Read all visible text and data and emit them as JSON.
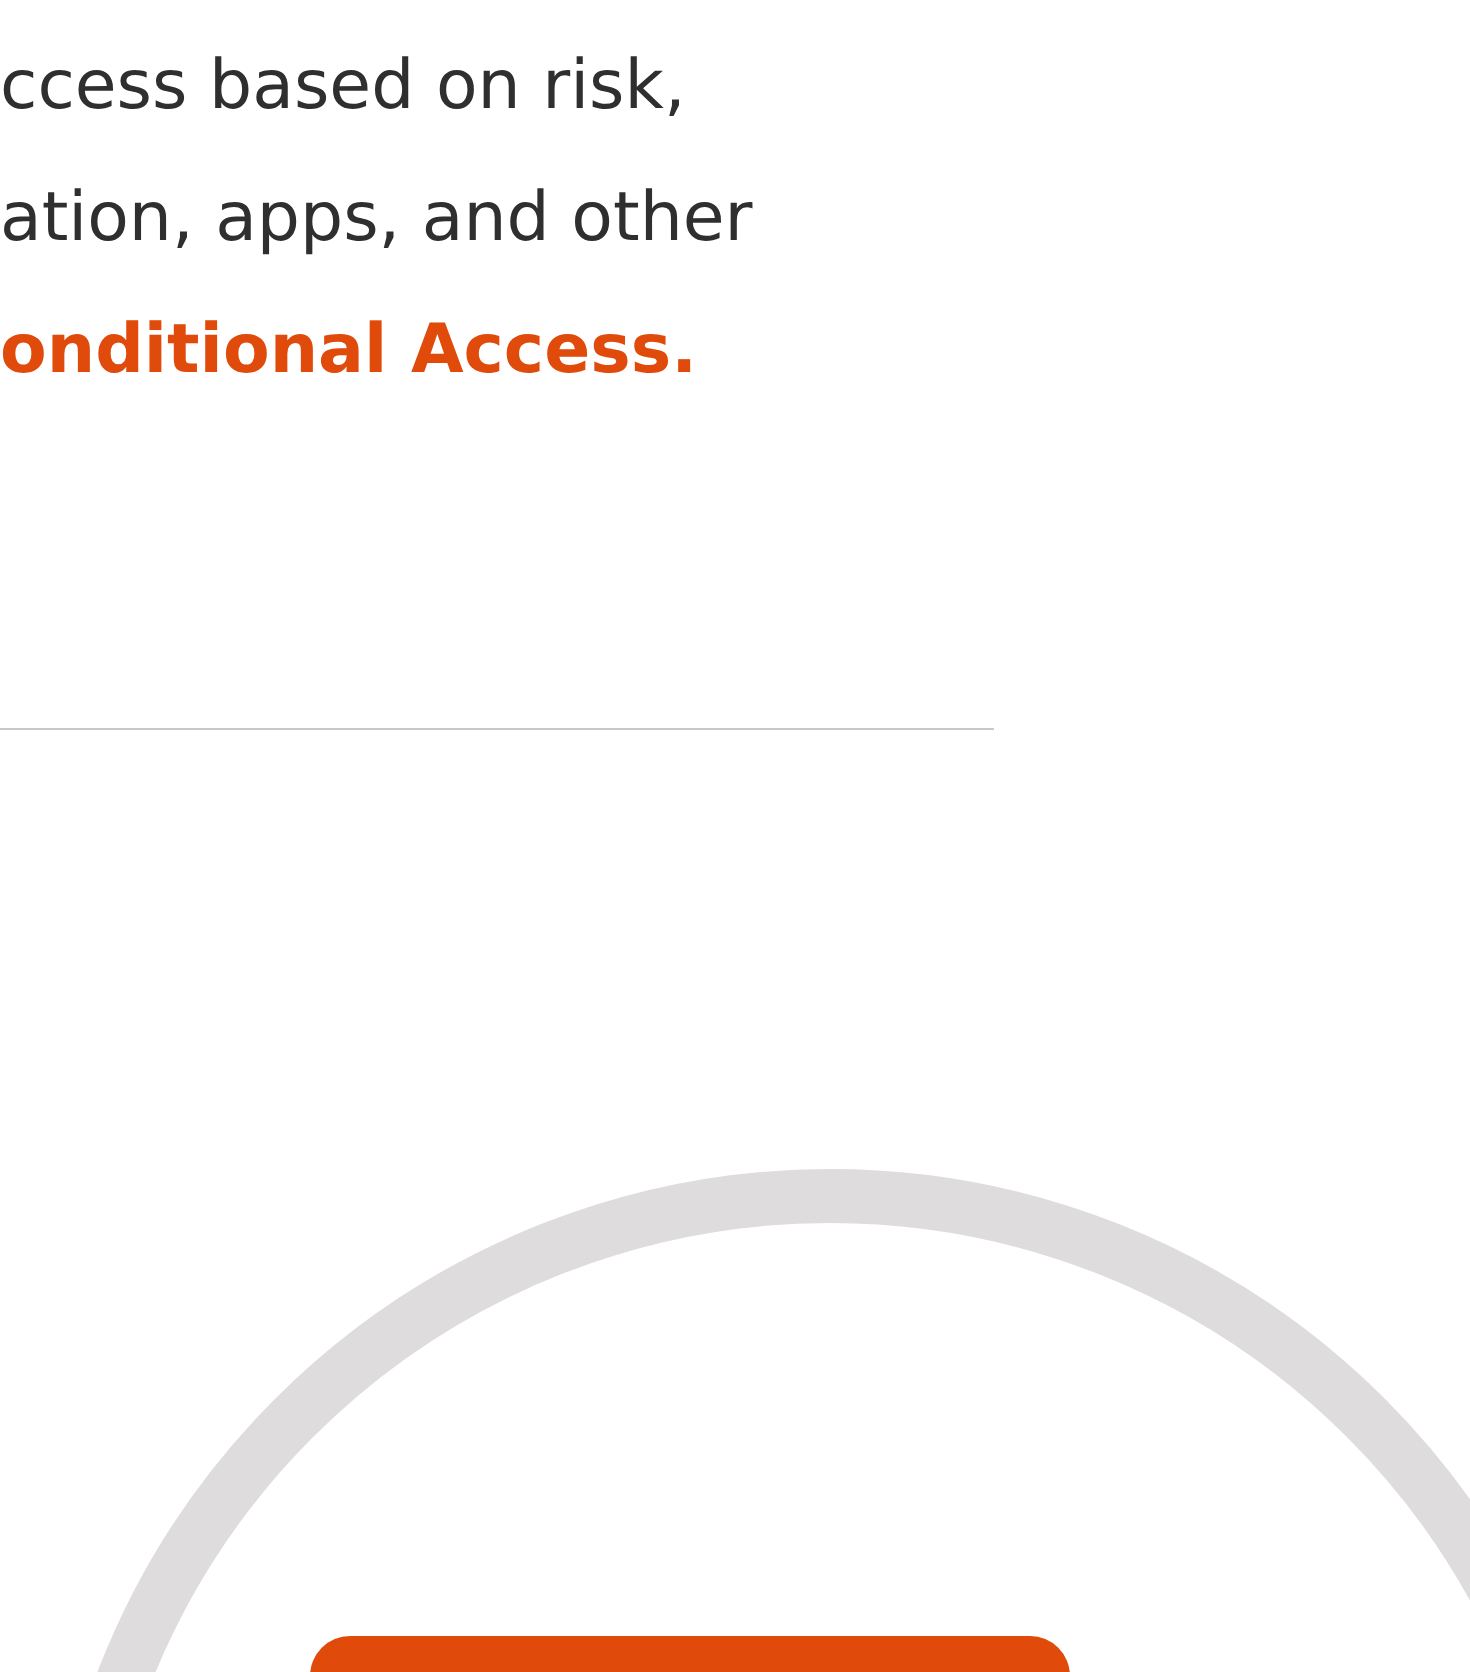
{
  "paragraph": {
    "lines": [
      "ccess based on risk,",
      "ation, apps, and other"
    ],
    "link": "onditional Access."
  },
  "call_to_action": {
    "kind": "button"
  }
}
